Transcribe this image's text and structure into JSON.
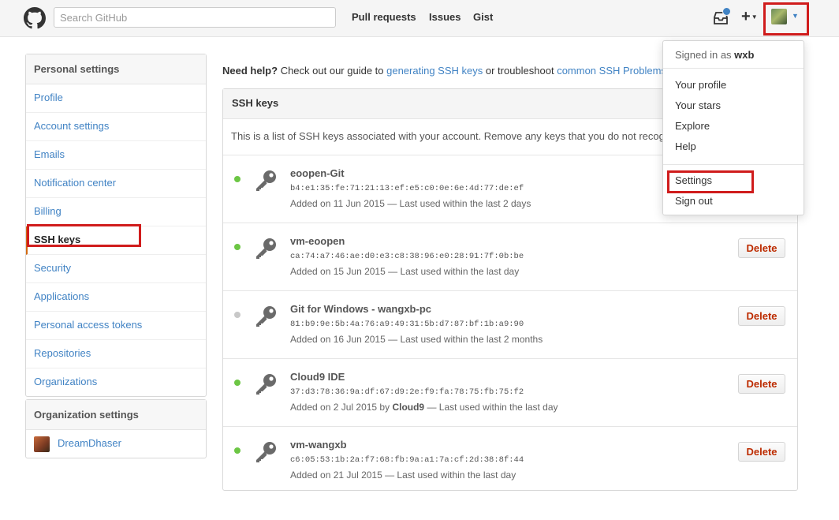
{
  "header": {
    "search_placeholder": "Search GitHub",
    "nav": [
      "Pull requests",
      "Issues",
      "Gist"
    ],
    "plus_label": "+",
    "icons": {
      "logo": "github-octocat-icon",
      "inbox": "inbox-icon",
      "caret": "caret-down-icon"
    }
  },
  "sidebar": {
    "personal_heading": "Personal settings",
    "items": [
      {
        "label": "Profile"
      },
      {
        "label": "Account settings"
      },
      {
        "label": "Emails"
      },
      {
        "label": "Notification center"
      },
      {
        "label": "Billing"
      },
      {
        "label": "SSH keys"
      },
      {
        "label": "Security"
      },
      {
        "label": "Applications"
      },
      {
        "label": "Personal access tokens"
      },
      {
        "label": "Repositories"
      },
      {
        "label": "Organizations"
      }
    ],
    "selected": "SSH keys",
    "org_heading": "Organization settings",
    "org_items": [
      {
        "label": "DreamDhaser"
      }
    ]
  },
  "help": {
    "lead": "Need help?",
    "text1": " Check out our guide to ",
    "link1": "generating SSH keys",
    "text2": " or troubleshoot ",
    "link2": "common SSH Problems"
  },
  "ssh": {
    "title": "SSH keys",
    "description": "This is a list of SSH keys associated with your account. Remove any keys that you do not recognize.",
    "delete_label": "Delete",
    "keys": [
      {
        "title": "eoopen-Git",
        "fingerprint": "b4:e1:35:fe:71:21:13:ef:e5:c0:0e:6e:4d:77:de:ef",
        "added_prefix": "Added on 11 Jun 2015",
        "added_by": "",
        "added_suffix": " — Last used within the last 2 days",
        "status_color": "#6cc644"
      },
      {
        "title": "vm-eoopen",
        "fingerprint": "ca:74:a7:46:ae:d0:e3:c8:38:96:e0:28:91:7f:0b:be",
        "added_prefix": "Added on 15 Jun 2015",
        "added_by": "",
        "added_suffix": " — Last used within the last day",
        "status_color": "#6cc644"
      },
      {
        "title": "Git for Windows - wangxb-pc",
        "fingerprint": "81:b9:9e:5b:4a:76:a9:49:31:5b:d7:87:bf:1b:a9:90",
        "added_prefix": "Added on 16 Jun 2015",
        "added_by": "",
        "added_suffix": " — Last used within the last 2 months",
        "status_color": "#c8c8c8"
      },
      {
        "title": "Cloud9 IDE",
        "fingerprint": "37:d3:78:36:9a:df:67:d9:2e:f9:fa:78:75:fb:75:f2",
        "added_prefix": "Added on 2 Jul 2015 by ",
        "added_by": "Cloud9",
        "added_suffix": " — Last used within the last day",
        "status_color": "#6cc644"
      },
      {
        "title": "vm-wangxb",
        "fingerprint": "c6:05:53:1b:2a:f7:68:fb:9a:a1:7a:cf:2d:38:8f:44",
        "added_prefix": "Added on 21 Jul 2015",
        "added_by": "",
        "added_suffix": " — Last used within the last day",
        "status_color": "#6cc644"
      }
    ]
  },
  "dropdown": {
    "signed_in_prefix": "Signed in as ",
    "username": "wxb",
    "items": [
      "Your profile",
      "Your stars",
      "Explore",
      "Help"
    ],
    "settings": "Settings",
    "sign_out": "Sign out"
  },
  "colors": {
    "link": "#4183c4",
    "highlight": "#d01c1c",
    "delete": "#bd2c00",
    "active_key": "#6cc644",
    "inactive_key": "#c8c8c8"
  }
}
